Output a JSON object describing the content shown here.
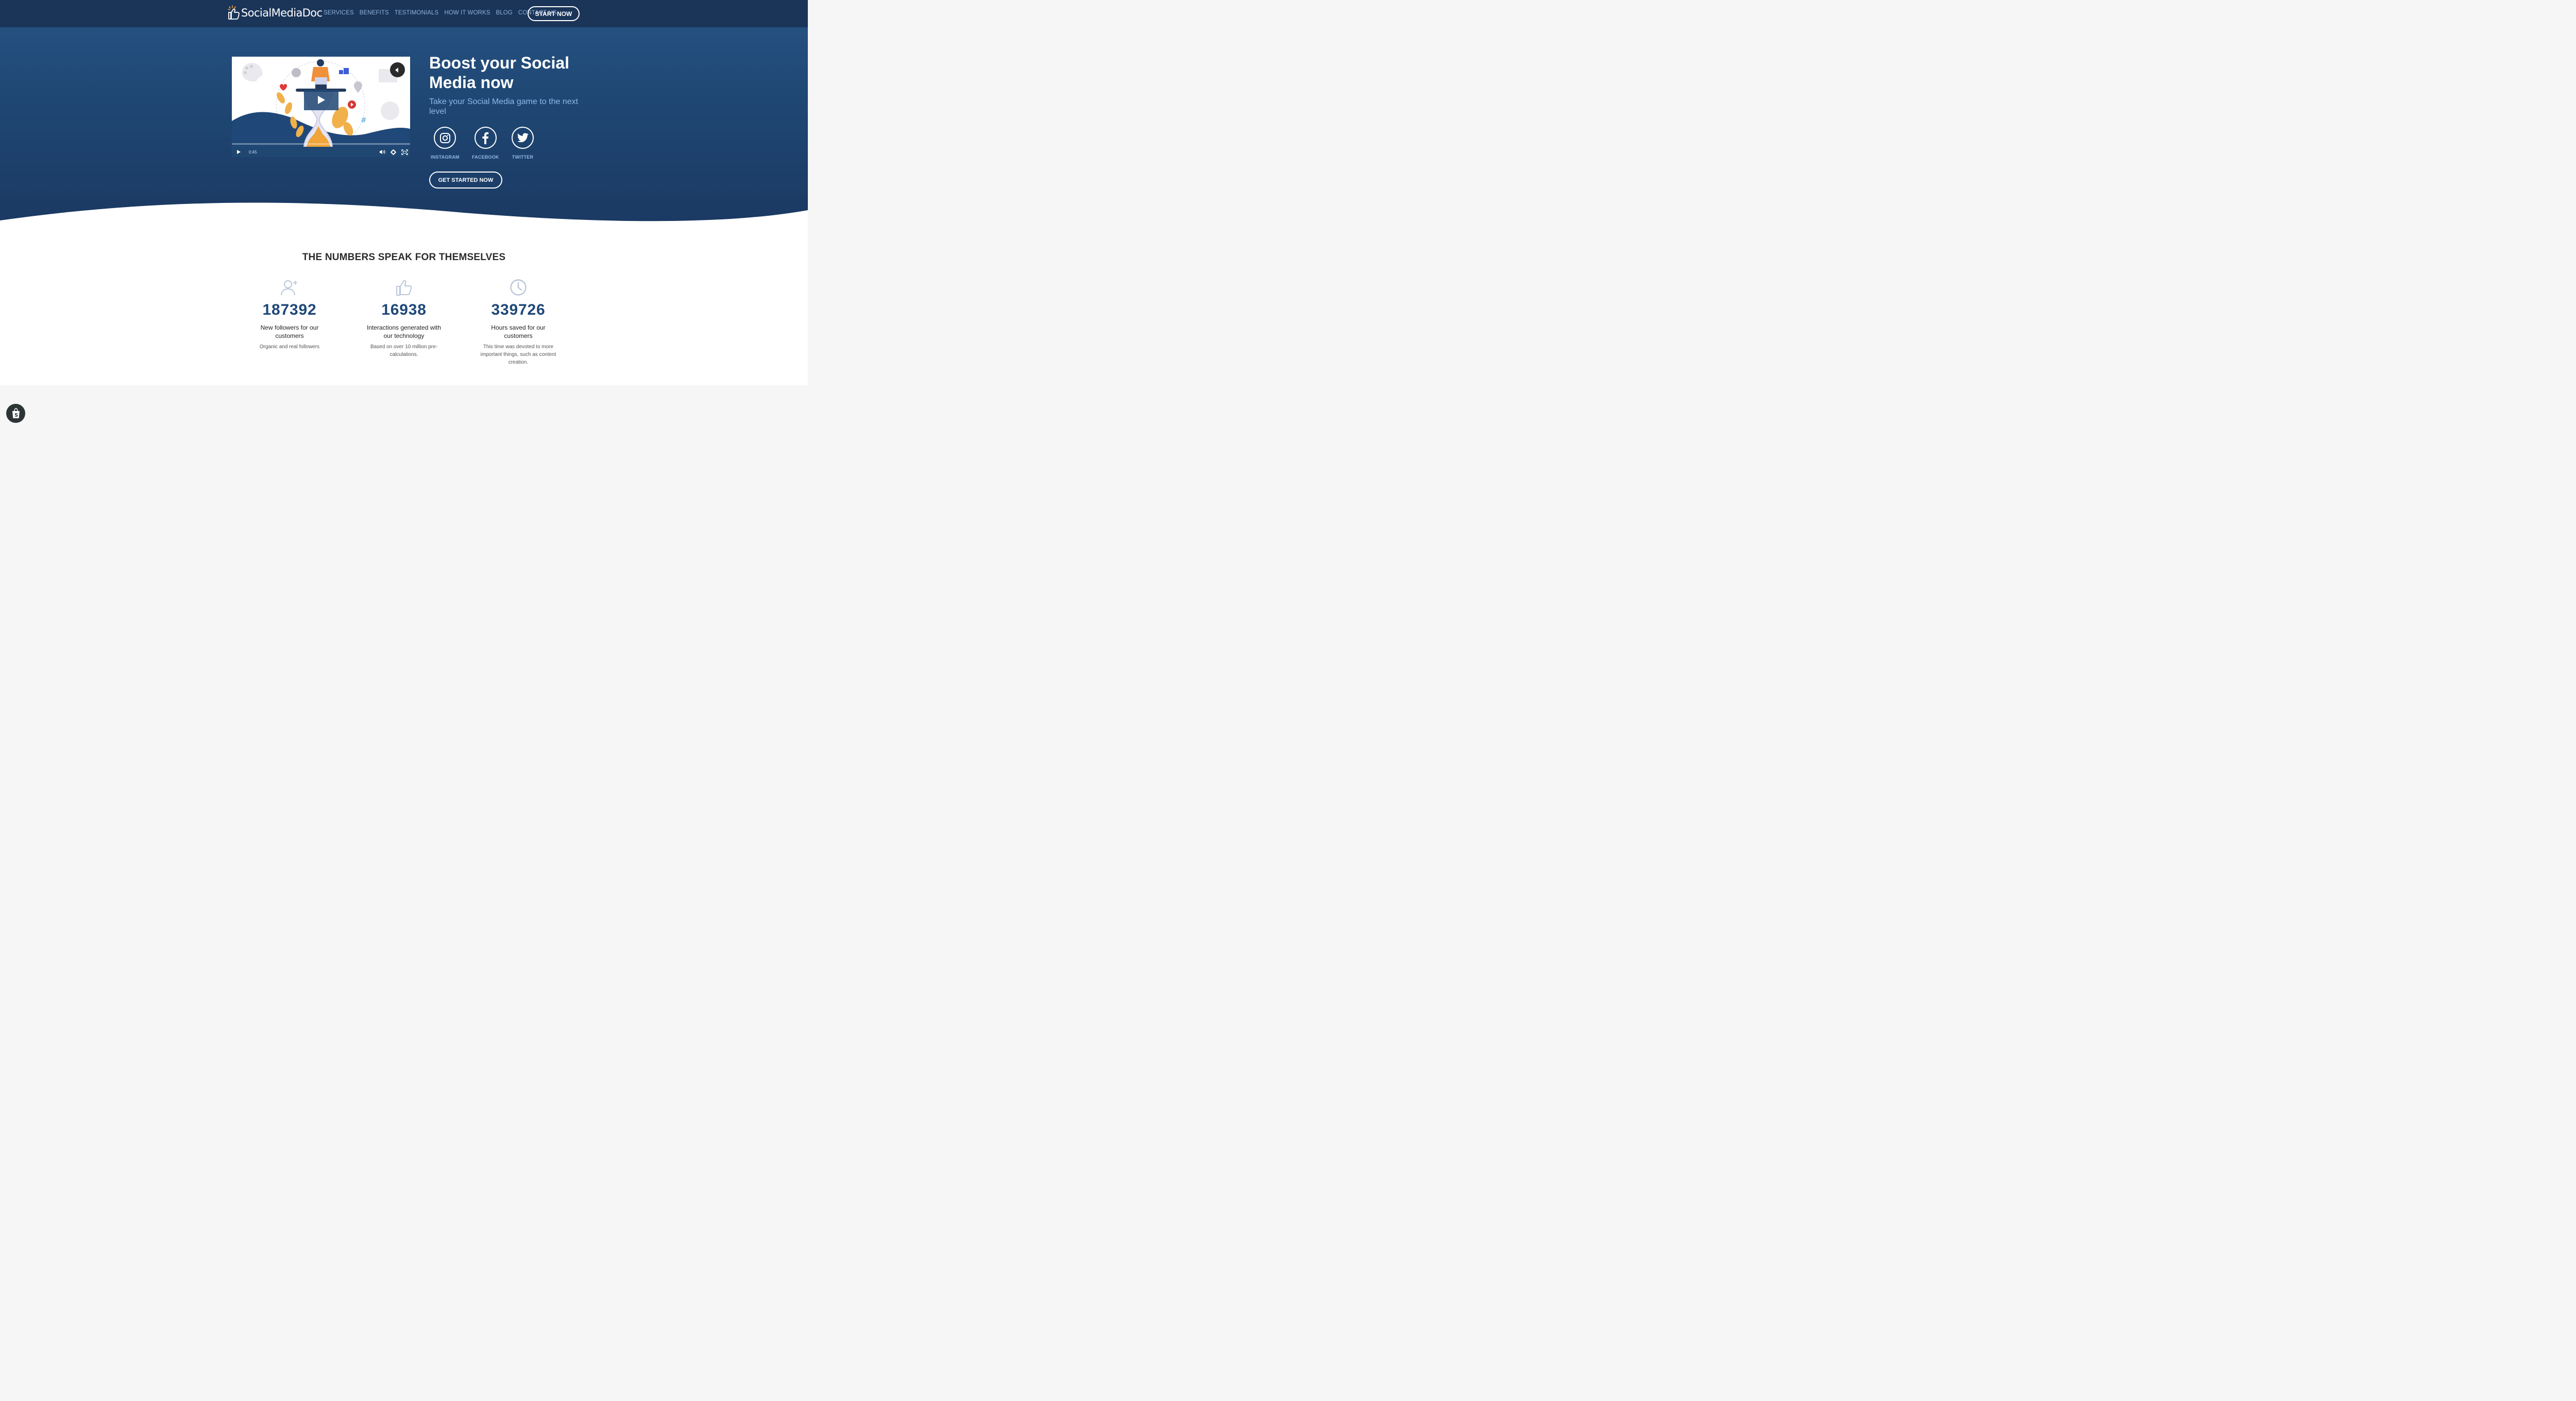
{
  "header": {
    "logo_text": "SocialMediaDoc",
    "nav": [
      "SERVICES",
      "BENEFITS",
      "TESTIMONIALS",
      "HOW IT WORKS",
      "BLOG",
      "CONTACT US"
    ],
    "cta_label": "START NOW"
  },
  "hero": {
    "title": "Boost your Social Media now",
    "subtitle": "Take your Social Media game to the next level",
    "video": {
      "time": "0:45"
    },
    "social": [
      {
        "label": "INSTAGRAM",
        "icon": "instagram-icon"
      },
      {
        "label": "FACEBOOK",
        "icon": "facebook-icon"
      },
      {
        "label": "TWITTER",
        "icon": "twitter-icon"
      }
    ],
    "cta_label": "GET STARTED NOW"
  },
  "stats": {
    "title": "THE NUMBERS SPEAK FOR THEMSELVES",
    "items": [
      {
        "icon": "add-user-icon",
        "value": "187392",
        "caption": "New followers for our customers",
        "note": "Organic and real followers"
      },
      {
        "icon": "thumbs-up-icon",
        "value": "16938",
        "caption": "Interactions generated with our technology",
        "note": "Based on over 10 million pre-calculations."
      },
      {
        "icon": "clock-icon",
        "value": "339726",
        "caption": "Hours saved for our customers",
        "note": "This time was devoted to more important things, such as content creation."
      }
    ]
  },
  "colors": {
    "header_bg": "#1b3559",
    "hero_bg": "#1e4470",
    "accent": "#1f4878",
    "nav_text": "#8fb0d6"
  }
}
